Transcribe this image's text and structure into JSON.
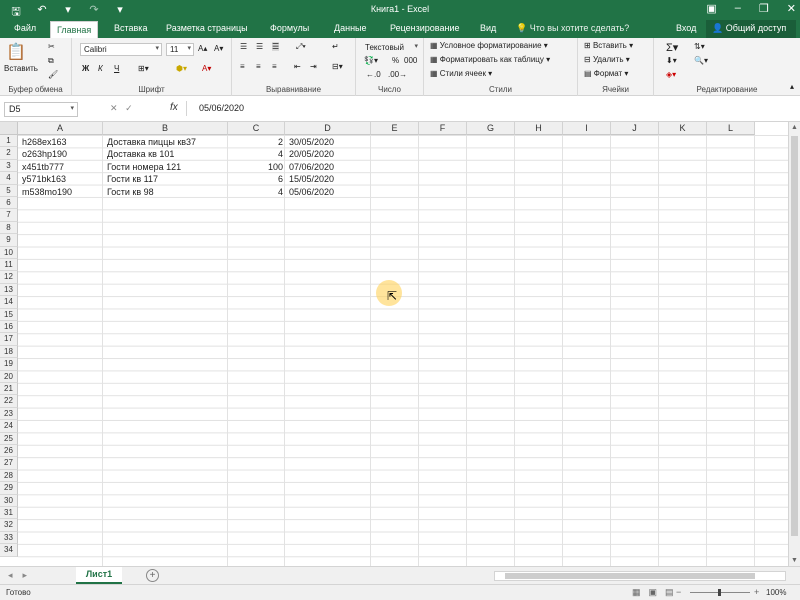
{
  "titlebar": {
    "title": "Книга1 - Excel",
    "save_icon": "save-icon",
    "undo_icon": "undo-icon",
    "redo_icon": "redo-icon"
  },
  "tabs": {
    "file": "Файл",
    "home": "Главная",
    "insert": "Вставка",
    "page_layout": "Разметка страницы",
    "formulas": "Формулы",
    "data": "Данные",
    "review": "Рецензирование",
    "view": "Вид",
    "tell_me": "Что вы хотите сделать?",
    "login": "Вход",
    "share": "Общий доступ"
  },
  "ribbon": {
    "clipboard": {
      "paste": "Вставить",
      "label": "Буфер обмена"
    },
    "font": {
      "name": "Calibri",
      "size": "11",
      "bold": "Ж",
      "italic": "К",
      "underline": "Ч",
      "label": "Шрифт"
    },
    "alignment": {
      "label": "Выравнивание"
    },
    "number": {
      "format": "Текстовый",
      "percent": "%",
      "thousands": "000",
      "label": "Число"
    },
    "styles": {
      "conditional": "Условное форматирование",
      "as_table": "Форматировать как таблицу",
      "cell_styles": "Стили ячеек",
      "label": "Стили"
    },
    "cells": {
      "insert": "Вставить",
      "delete": "Удалить",
      "format": "Формат",
      "label": "Ячейки"
    },
    "editing": {
      "label": "Редактирование"
    }
  },
  "formula_bar": {
    "name_box": "D5",
    "fx": "fx",
    "value": "05/06/2020"
  },
  "sheet": {
    "columns": [
      "A",
      "B",
      "C",
      "D",
      "E",
      "F",
      "G",
      "H",
      "I",
      "J",
      "K",
      "L"
    ],
    "rows": [
      "1",
      "2",
      "3",
      "4",
      "5",
      "6",
      "7",
      "8",
      "9",
      "10",
      "11",
      "12",
      "13",
      "14",
      "15",
      "16",
      "17",
      "18",
      "19",
      "20",
      "21",
      "22",
      "23",
      "24",
      "25",
      "26",
      "27",
      "28",
      "29",
      "30",
      "31",
      "32",
      "33",
      "34"
    ],
    "data": [
      [
        "h268ex163",
        "Доставка пиццы кв37",
        "2",
        "30/05/2020"
      ],
      [
        "o263hp190",
        "Доставка кв 101",
        "4",
        "20/05/2020"
      ],
      [
        "x451tb777",
        "Гости номера 121",
        "100",
        "07/06/2020"
      ],
      [
        "y571bk163",
        "Гости кв 117",
        "6",
        "15/05/2020"
      ],
      [
        "m538mo190",
        "Гости кв 98",
        "4",
        "05/06/2020"
      ]
    ]
  },
  "sheet_tabs": {
    "active": "Лист1",
    "add": "+"
  },
  "status": {
    "ready": "Готово",
    "zoom": "100%",
    "zoom_minus": "−",
    "zoom_plus": "+"
  }
}
